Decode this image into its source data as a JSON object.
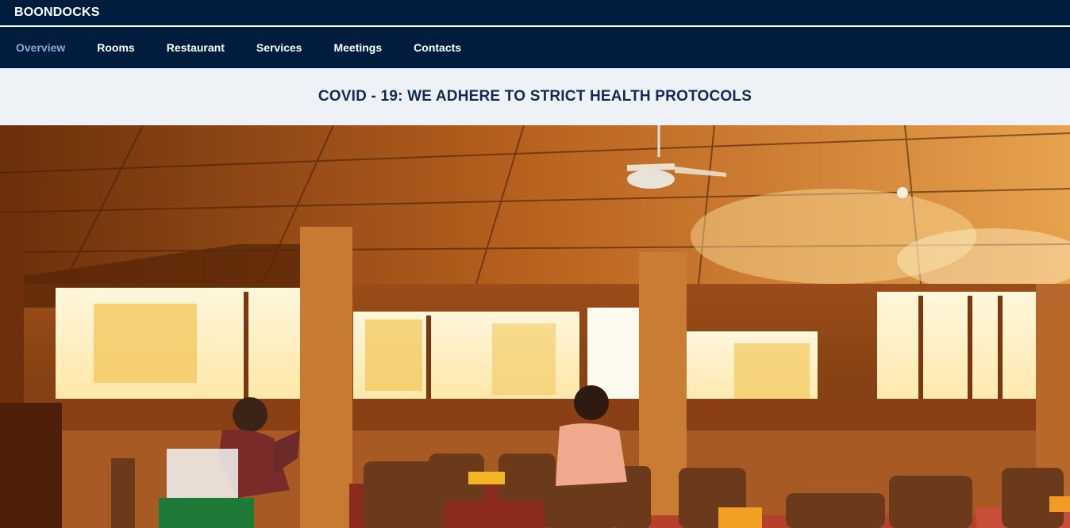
{
  "brand": {
    "name": "BOONDOCKS"
  },
  "nav": {
    "items": [
      {
        "label": "Overview",
        "active": true
      },
      {
        "label": "Rooms"
      },
      {
        "label": "Restaurant"
      },
      {
        "label": "Services"
      },
      {
        "label": "Meetings"
      },
      {
        "label": "Contacts"
      }
    ]
  },
  "notice": {
    "text": "COVID - 19: WE ADHERE TO STRICT HEALTH PROTOCOLS"
  },
  "hero": {
    "image": "restaurant-interior-photo"
  },
  "colors": {
    "header_bg": "#001d3d",
    "active_link": "#8fa6dd",
    "notice_bg": "#eef1f6",
    "notice_text": "#0f2b55"
  }
}
